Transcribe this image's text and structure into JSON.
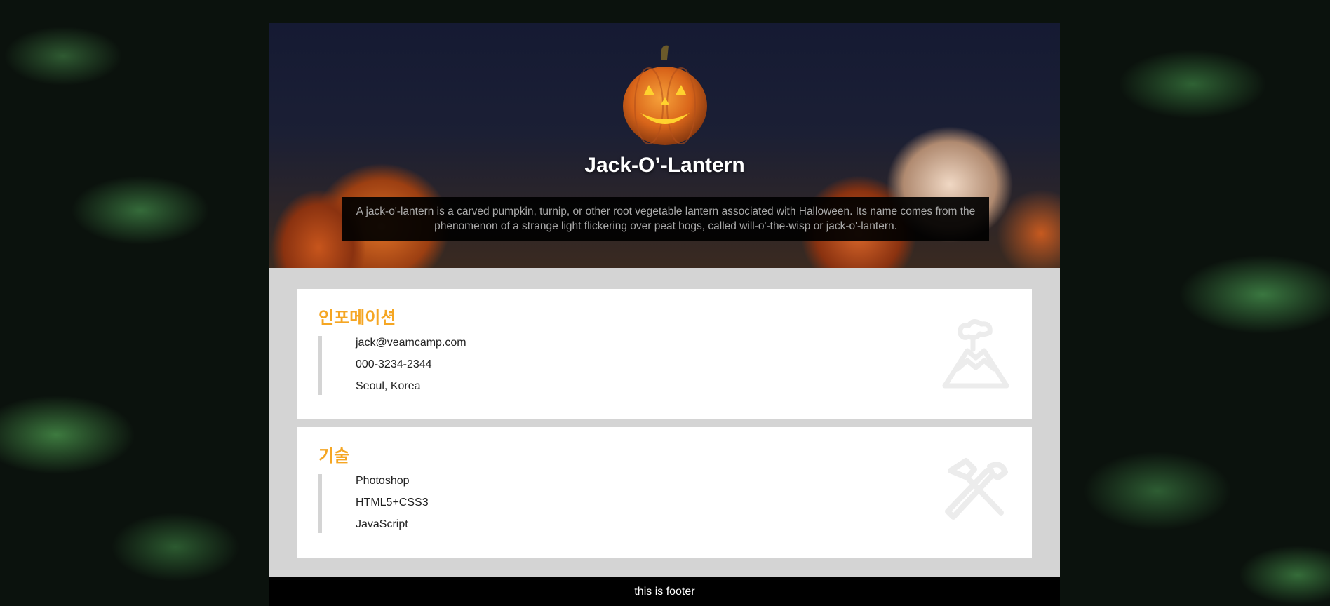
{
  "hero": {
    "title": "Jack-O’-Lantern",
    "description": "A jack-o'-lantern is a carved pumpkin, turnip, or other root vegetable lantern associated with Halloween. Its name comes from the phenomenon of a strange light flickering over peat bogs, called will-o'-the-wisp or jack-o'-lantern."
  },
  "info": {
    "title": "인포메이션",
    "items": [
      "jack@veamcamp.com",
      "000-3234-2344",
      "Seoul, Korea"
    ],
    "icon": "volcano-icon"
  },
  "skills": {
    "title": "기술",
    "items": [
      "Photoshop",
      "HTML5+CSS3",
      "JavaScript"
    ],
    "icon": "tools-icon"
  },
  "footer": {
    "text": "this is footer"
  },
  "colors": {
    "accent": "#f5a623",
    "card_bg": "#ffffff",
    "page_bg": "#d4d4d4"
  }
}
